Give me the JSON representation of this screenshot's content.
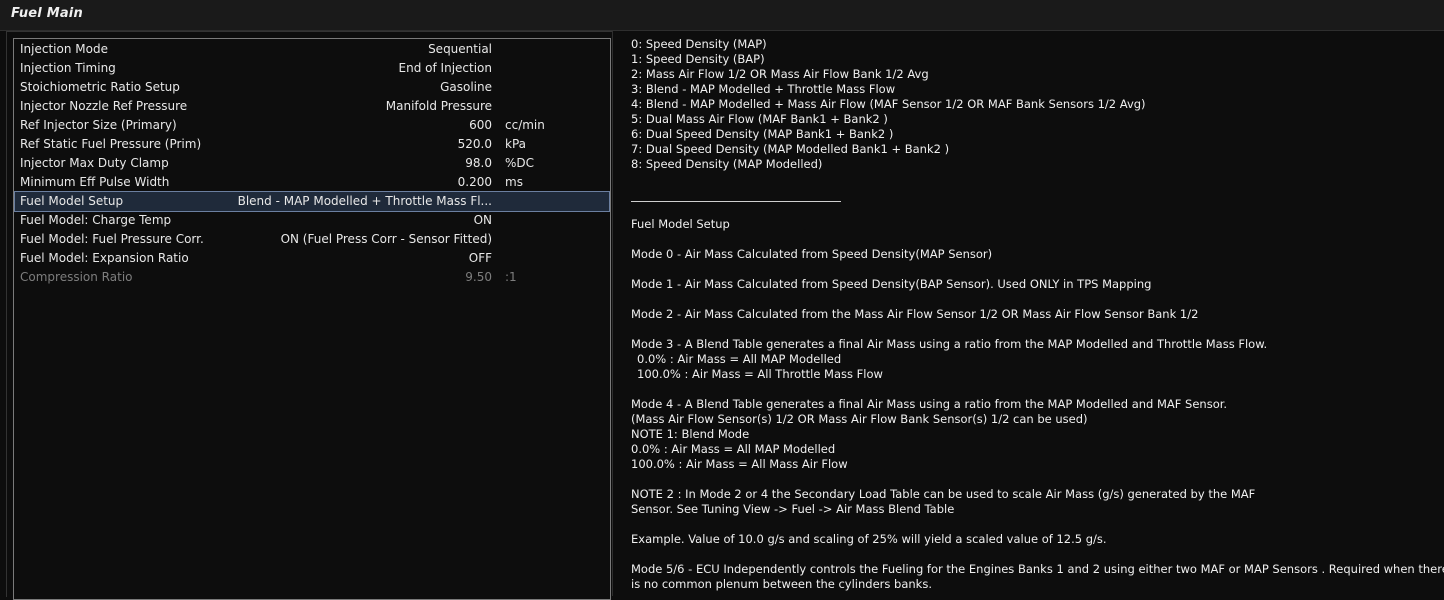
{
  "window": {
    "title": "Fuel Main"
  },
  "settings": {
    "rows": [
      {
        "label": "Injection Mode",
        "value": "Sequential",
        "unit": ""
      },
      {
        "label": "Injection Timing",
        "value": "End of Injection",
        "unit": ""
      },
      {
        "label": "Stoichiometric Ratio Setup",
        "value": "Gasoline",
        "unit": ""
      },
      {
        "label": "Injector Nozzle Ref Pressure",
        "value": "Manifold Pressure",
        "unit": ""
      },
      {
        "label": "Ref Injector Size (Primary)",
        "value": "600",
        "unit": "cc/min"
      },
      {
        "label": "Ref Static Fuel Pressure (Prim)",
        "value": "520.0",
        "unit": "kPa"
      },
      {
        "label": "Injector Max Duty Clamp",
        "value": "98.0",
        "unit": "%DC"
      },
      {
        "label": "Minimum Eff Pulse Width",
        "value": "0.200",
        "unit": "ms"
      },
      {
        "label": "Fuel Model Setup",
        "value": "Blend - MAP Modelled + Throttle Mass Fl...",
        "unit": ""
      },
      {
        "label": "Fuel Model: Charge Temp",
        "value": "ON",
        "unit": ""
      },
      {
        "label": "Fuel Model: Fuel Pressure Corr.",
        "value": "ON (Fuel Press Corr - Sensor Fitted)",
        "unit": ""
      },
      {
        "label": "Fuel Model: Expansion Ratio",
        "value": "OFF",
        "unit": ""
      },
      {
        "label": "Compression Ratio",
        "value": "9.50",
        "unit": ":1"
      }
    ]
  },
  "help": {
    "options": [
      "0: Speed Density (MAP)",
      "1: Speed Density (BAP)",
      "2: Mass Air Flow 1/2 OR Mass Air Flow Bank 1/2 Avg",
      "3: Blend - MAP Modelled + Throttle Mass Flow",
      "4: Blend -  MAP Modelled + Mass Air Flow  (MAF Sensor 1/2 OR MAF Bank Sensors 1/2 Avg)",
      "5: Dual Mass Air Flow (MAF Bank1 + Bank2 )",
      "6: Dual Speed Density (MAP Bank1 + Bank2 )",
      "7: Dual Speed Density (MAP Modelled Bank1 + Bank2 )",
      "8: Speed Density (MAP Modelled)"
    ],
    "heading": "Fuel Model Setup",
    "mode0": "Mode 0 - Air Mass Calculated from Speed Density(MAP Sensor)",
    "mode1": "Mode 1 - Air Mass Calculated from Speed Density(BAP Sensor). Used ONLY in TPS Mapping",
    "mode2": "Mode 2 - Air Mass Calculated from the Mass Air Flow Sensor 1/2 OR Mass Air Flow Sensor Bank 1/2",
    "mode3": [
      "Mode 3 -  A Blend Table generates a final Air  Mass using a ratio from the  MAP Modelled and Throttle Mass Flow.",
      "  0.0%   : Air Mass =  All  MAP Modelled",
      "  100.0% : Air Mass =  All Throttle Mass Flow"
    ],
    "mode4": [
      "Mode 4 - A Blend Table generates a final Air  Mass using a ratio from the MAP Modelled and MAF Sensor.",
      "(Mass Air Flow Sensor(s) 1/2 OR Mass Air Flow Bank Sensor(s) 1/2 can be used)",
      "NOTE 1: Blend Mode",
      "0.0%   : Air Mass =  All  MAP Modelled",
      "100.0% : Air Mass =  All Mass Air Flow"
    ],
    "note2": [
      "NOTE 2 : In Mode 2 or 4 the Secondary Load Table can  be used to scale Air Mass (g/s) generated by the MAF",
      "Sensor.   See Tuning View -> Fuel  -> Air Mass Blend Table"
    ],
    "example": "Example. Value of 10.0 g/s and scaling of 25% will yield a scaled value of 12.5 g/s.",
    "mode56": [
      "Mode 5/6 -  ECU Independently controls the Fueling for the Engines Banks  1 and 2 using either two MAF or MAP Sensors . Required when there",
      "is no common plenum between the cylinders banks."
    ]
  }
}
